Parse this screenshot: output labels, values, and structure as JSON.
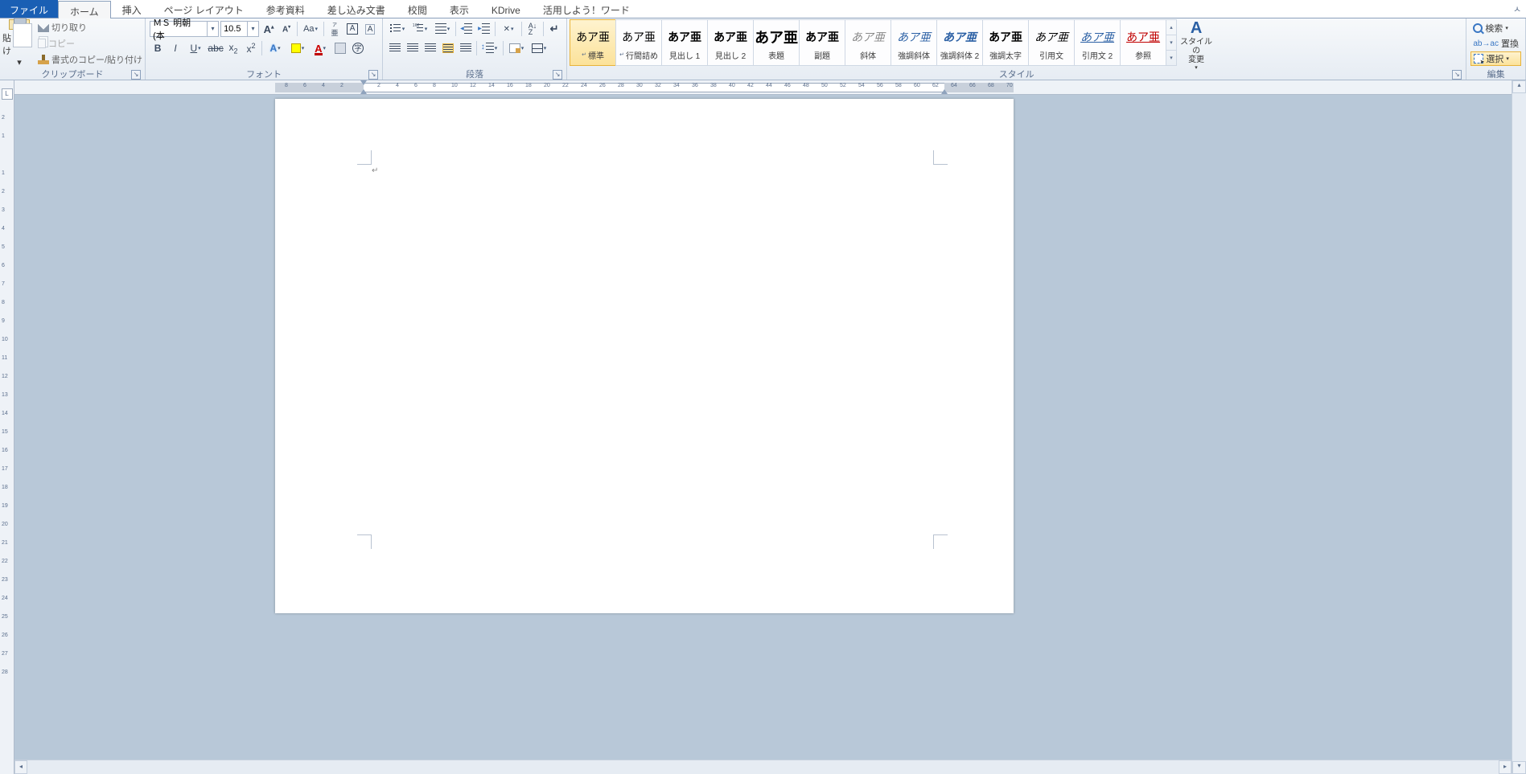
{
  "tabs": {
    "file": "ファイル",
    "home": "ホーム",
    "insert": "挿入",
    "page_layout": "ページ レイアウト",
    "references": "参考資料",
    "mailings": "差し込み文書",
    "review": "校閲",
    "view": "表示",
    "kdrive": "KDrive",
    "tips": "活用しよう！ワード"
  },
  "collapse_glyph": "ㅅ",
  "clipboard": {
    "paste": "貼り付け",
    "cut": "切り取り",
    "copy": "コピー",
    "format_painter": "書式のコピー/貼り付け",
    "label": "クリップボード"
  },
  "font": {
    "name": "ＭＳ 明朝 (本",
    "size": "10.5",
    "label": "フォント"
  },
  "paragraph": {
    "label": "段落"
  },
  "styles": {
    "items": [
      {
        "preview": "あア亜",
        "name": "標準",
        "style": "",
        "sel": true,
        "arrow": true
      },
      {
        "preview": "あア亜",
        "name": "行間詰め",
        "style": "",
        "arrow": true
      },
      {
        "preview": "あア亜",
        "name": "見出し 1",
        "style": "font-weight:bold"
      },
      {
        "preview": "あア亜",
        "name": "見出し 2",
        "style": "font-weight:bold"
      },
      {
        "preview": "あア亜",
        "name": "表題",
        "style": "font-weight:bold;font-size:18px"
      },
      {
        "preview": "あア亜",
        "name": "副題",
        "style": "font-weight:bold"
      },
      {
        "preview": "あア亜",
        "name": "斜体",
        "style": "font-style:italic;color:#888"
      },
      {
        "preview": "あア亜",
        "name": "強調斜体",
        "style": "font-style:italic;color:#2a5fa4"
      },
      {
        "preview": "あア亜",
        "name": "強調斜体 2",
        "style": "font-style:italic;font-weight:bold;color:#2a5fa4"
      },
      {
        "preview": "あア亜",
        "name": "強調太字",
        "style": "font-weight:bold"
      },
      {
        "preview": "あア亜",
        "name": "引用文",
        "style": "font-style:italic"
      },
      {
        "preview": "あア亜",
        "name": "引用文 2",
        "style": "font-style:italic;color:#2a5fa4;text-decoration:underline"
      },
      {
        "preview": "あア亜",
        "name": "参照",
        "style": "color:#c00000;text-decoration:underline"
      }
    ],
    "change": "スタイルの\n変更",
    "label": "スタイル"
  },
  "editing": {
    "find": "検索",
    "replace": "置換",
    "select": "選択",
    "label": "編集"
  },
  "ruler_corner": "L",
  "cursor_mark": "↵",
  "hruler_ticks": [
    "8",
    "6",
    "4",
    "2",
    "",
    "2",
    "4",
    "6",
    "8",
    "10",
    "12",
    "14",
    "16",
    "18",
    "20",
    "22",
    "24",
    "26",
    "28",
    "30",
    "32",
    "34",
    "36",
    "38",
    "40",
    "42",
    "44",
    "46",
    "48",
    "50",
    "52",
    "54",
    "56",
    "58",
    "60",
    "62",
    "64",
    "66",
    "68",
    "70"
  ],
  "vruler_ticks": [
    "",
    "2",
    "1",
    "",
    "1",
    "2",
    "3",
    "4",
    "5",
    "6",
    "7",
    "8",
    "9",
    "10",
    "11",
    "12",
    "13",
    "14",
    "15",
    "16",
    "17",
    "18",
    "19",
    "20",
    "21",
    "22",
    "23",
    "24",
    "25",
    "26",
    "27",
    "28"
  ]
}
